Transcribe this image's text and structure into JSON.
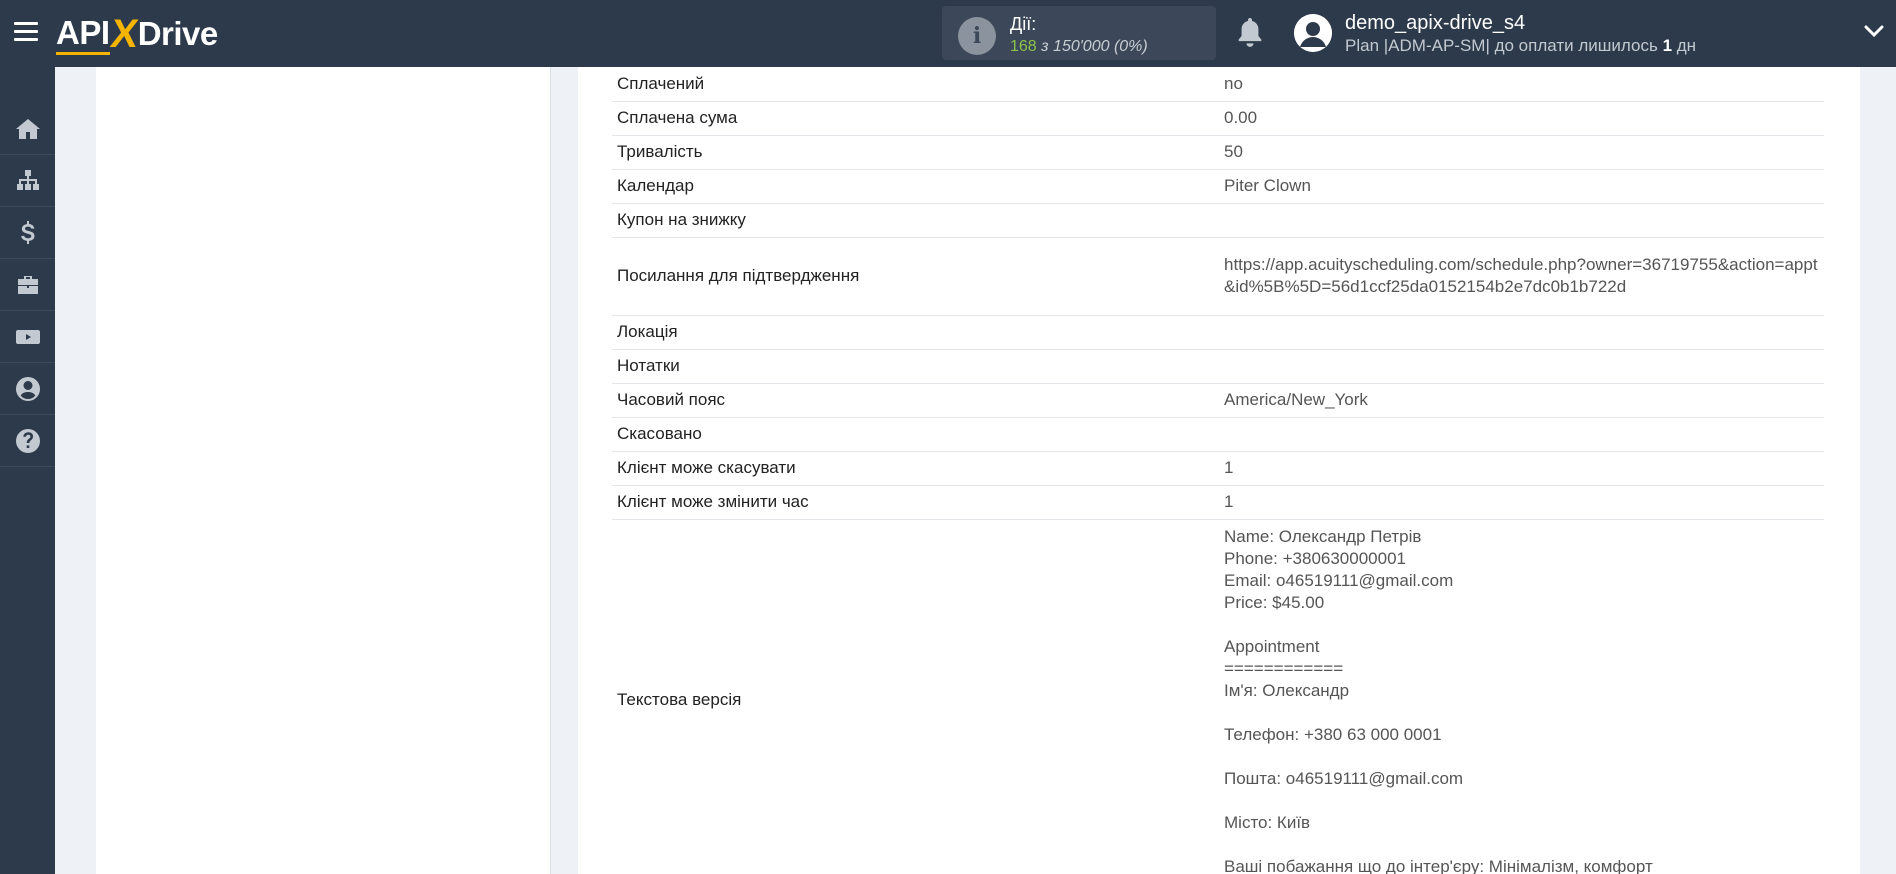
{
  "header": {
    "logo_text_api": "API",
    "logo_text_x": "X",
    "logo_text_drive": "Drive",
    "actions_label": "Дії:",
    "actions_used": "168",
    "actions_of": "з 150'000",
    "actions_percent": "(0%)",
    "username": "demo_apix-drive_s4",
    "plan_prefix": "Plan |ADM-AP-SM| до оплати лишилось",
    "plan_days_num": "1",
    "plan_days_unit": "дн"
  },
  "sidebar": {
    "items": [
      {
        "icon": "home-icon"
      },
      {
        "icon": "sitemap-icon"
      },
      {
        "icon": "dollar-icon"
      },
      {
        "icon": "briefcase-icon"
      },
      {
        "icon": "youtube-icon"
      },
      {
        "icon": "user-icon"
      },
      {
        "icon": "help-icon"
      }
    ]
  },
  "table": {
    "rows": [
      {
        "key": "Сплачений",
        "value": "no"
      },
      {
        "key": "Сплачена сума",
        "value": "0.00"
      },
      {
        "key": "Тривалість",
        "value": "50"
      },
      {
        "key": "Календар",
        "value": "Piter Clown"
      },
      {
        "key": "Купон на знижку",
        "value": ""
      },
      {
        "key": "Посилання для підтвердження",
        "value": "https://app.acuityscheduling.com/schedule.php?owner=36719755&action=appt&id%5B%5D=56d1ccf25da0152154b2e7dc0b1b722d"
      },
      {
        "key": "Локація",
        "value": ""
      },
      {
        "key": "Нотатки",
        "value": ""
      },
      {
        "key": "Часовий пояс",
        "value": "America/New_York"
      },
      {
        "key": "Скасовано",
        "value": ""
      },
      {
        "key": "Клієнт може скасувати",
        "value": "1"
      },
      {
        "key": "Клієнт може змінити час",
        "value": "1"
      },
      {
        "key": "Текстова версія",
        "value": "Name: Олександр Петрів\nPhone: +380630000001\nEmail: o46519111@gmail.com\nPrice: $45.00\n\nAppointment\n============\nІм'я: Олександр\n\nТелефон: +380 63 000 0001\n\nПошта: o46519111@gmail.com\n\nМісто: Київ\n\nВаші побажання що до інтер'єру: Мінімалізм, комфорт"
      }
    ]
  }
}
